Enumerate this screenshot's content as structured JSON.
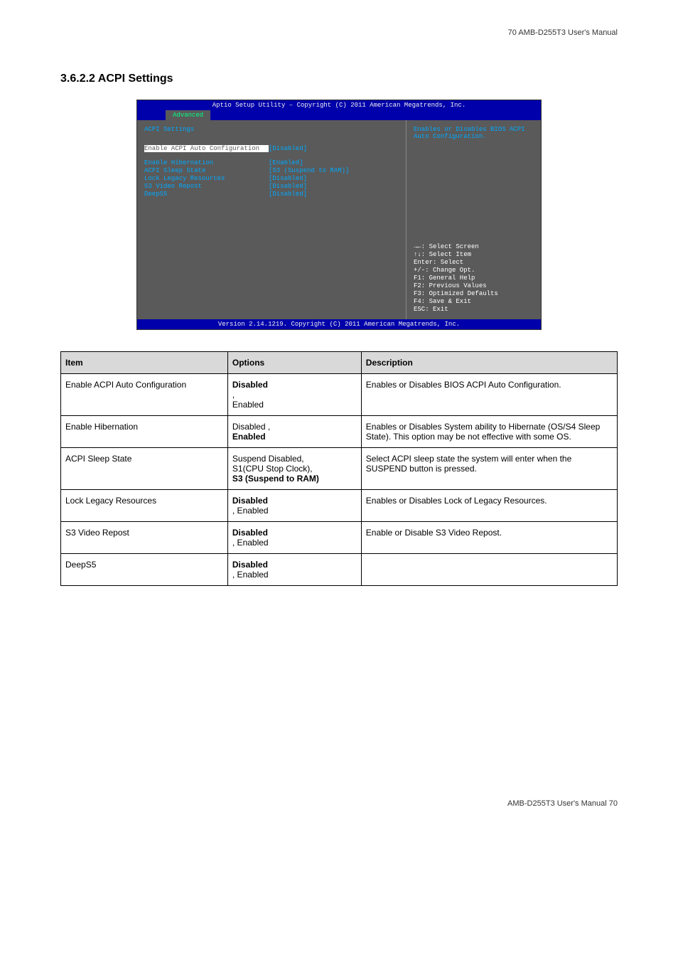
{
  "header": "70 AMB-D255T3 User's Manual",
  "section_title": "3.6.2.2 ACPI Settings",
  "bios": {
    "title": "Aptio Setup Utility – Copyright (C) 2011 American Megatrends, Inc.",
    "tab": "Advanced",
    "group_title": "ACPI Settings",
    "rows": [
      {
        "label": "Enable ACPI Auto Configuration",
        "value": "[Disabled]",
        "highlight": true,
        "spacer": true
      },
      {
        "label": "Enable Hibernation",
        "value": "[Enabled]"
      },
      {
        "label": "ACPI Sleep State",
        "value": "[S3 (Suspend to RAM)]"
      },
      {
        "label": "Lock Legacy Resources",
        "value": "[Disabled]"
      },
      {
        "label": "S3 Video Repost",
        "value": "[Disabled]"
      },
      {
        "label": "DeepS5",
        "value": "[Disabled]"
      }
    ],
    "help": "Enables or Disables BIOS ACPI Auto Configuration.",
    "keys": [
      "→←: Select Screen",
      "↑↓: Select Item",
      "Enter: Select",
      "+/-: Change Opt.",
      "F1: General Help",
      "F2: Previous Values",
      "F3: Optimized Defaults",
      "F4: Save & Exit",
      "ESC: Exit"
    ],
    "footer": "Version 2.14.1219. Copyright (C) 2011 American Megatrends, Inc."
  },
  "table": {
    "headers": [
      "Item",
      "Options",
      "Description"
    ],
    "rows": [
      {
        "item": "Enable ACPI Auto Configuration",
        "options": [
          {
            "t": "Disabled",
            "b": true
          },
          {
            "t": " ,"
          },
          {
            "t": "Enabled"
          }
        ],
        "desc": "Enables or Disables BIOS ACPI Auto Configuration."
      },
      {
        "item": "Enable Hibernation",
        "options": [
          {
            "t": "Disabled ,"
          },
          {
            "t": "Enabled",
            "b": true
          }
        ],
        "desc": "Enables or Disables System ability to Hibernate (OS/S4 Sleep State). This option may be not effective with some OS."
      },
      {
        "item": "ACPI Sleep State",
        "options": [
          {
            "t": "Suspend Disabled,"
          },
          {
            "t": "S1(CPU Stop Clock),"
          },
          {
            "t": "S3 (Suspend to RAM)",
            "b": true
          }
        ],
        "desc": "Select ACPI sleep state the system will enter when the SUSPEND button is pressed."
      },
      {
        "item": "Lock Legacy Resources",
        "options": [
          {
            "t": "Disabled",
            "b": true
          },
          {
            "t": " , Enabled"
          }
        ],
        "desc": "Enables or Disables Lock of Legacy Resources."
      },
      {
        "item": "S3 Video Repost",
        "options": [
          {
            "t": "Disabled",
            "b": true
          },
          {
            "t": " , Enabled"
          }
        ],
        "desc": "Enable or Disable S3 Video Repost."
      },
      {
        "item": "DeepS5",
        "options": [
          {
            "t": "Disabled",
            "b": true
          },
          {
            "t": " , Enabled"
          }
        ],
        "desc": ""
      }
    ]
  },
  "footer": "AMB-D255T3 User's Manual 70"
}
